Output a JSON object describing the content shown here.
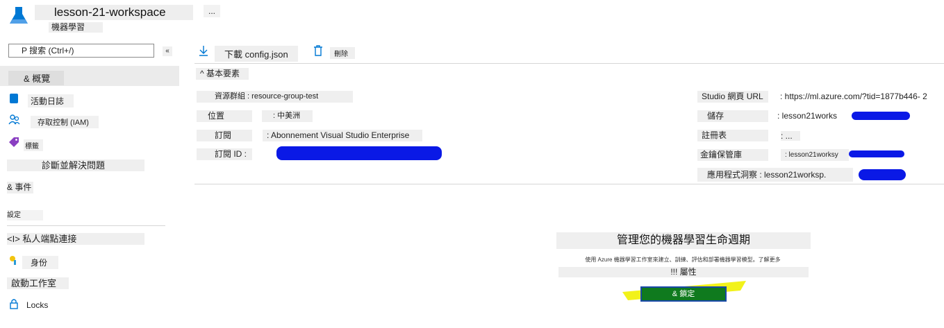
{
  "header": {
    "workspace_name": "lesson-21-workspace",
    "subtitle": "機器學習",
    "more": "..."
  },
  "sidebar": {
    "search_placeholder": "P 搜索 (Ctrl+/)",
    "collapse": "«",
    "items": [
      {
        "label": "& 概覽"
      },
      {
        "label": "活動日誌"
      },
      {
        "label": "存取控制 (IAM)"
      },
      {
        "label": "標籤"
      },
      {
        "label": "診斷並解決問題"
      },
      {
        "label": "& 事件"
      }
    ],
    "section_settings": "設定",
    "settings_items": [
      {
        "label": "<I> 私人端點連接"
      },
      {
        "label": "身份"
      },
      {
        "label": "啟動工作室"
      },
      {
        "label": "Locks"
      }
    ]
  },
  "toolbar": {
    "download_label": "下載 config.json",
    "delete_label": "刪除"
  },
  "essentials": {
    "heading": "^ 基本要素",
    "left": [
      {
        "label": "資源群組 : resource-group-test",
        "value": ""
      },
      {
        "label": "位置",
        "value": ": 中美洲"
      },
      {
        "label": "訂閱",
        "value": ": Abonnement Visual Studio Enterprise"
      },
      {
        "label": "訂閱 ID :",
        "value": ""
      }
    ],
    "right": [
      {
        "label": "Studio 網頁 URL",
        "value": ": https://ml.azure.com/?tid=1877b446- 2"
      },
      {
        "label": "儲存",
        "value": ": lesson21works"
      },
      {
        "label": "註冊表",
        "value": ": ..."
      },
      {
        "label": "金鑰保管庫",
        "value": ": lesson21worksy"
      },
      {
        "label": "應用程式洞察 : lesson21worksp.",
        "value": ""
      }
    ]
  },
  "promo": {
    "title": "管理您的機器學習生命週期",
    "description": "使用 Azure 機器學習工作室來建立、訓練、評估和部署機器學習模型。了解更多",
    "properties": "!!! 屬性",
    "button_label": "& 鎖定"
  },
  "colors": {
    "accent_blue": "#0078d4",
    "redaction": "#0a19e6",
    "button_green": "#0f7a1e",
    "highlight_yellow": "#f2f21a"
  }
}
